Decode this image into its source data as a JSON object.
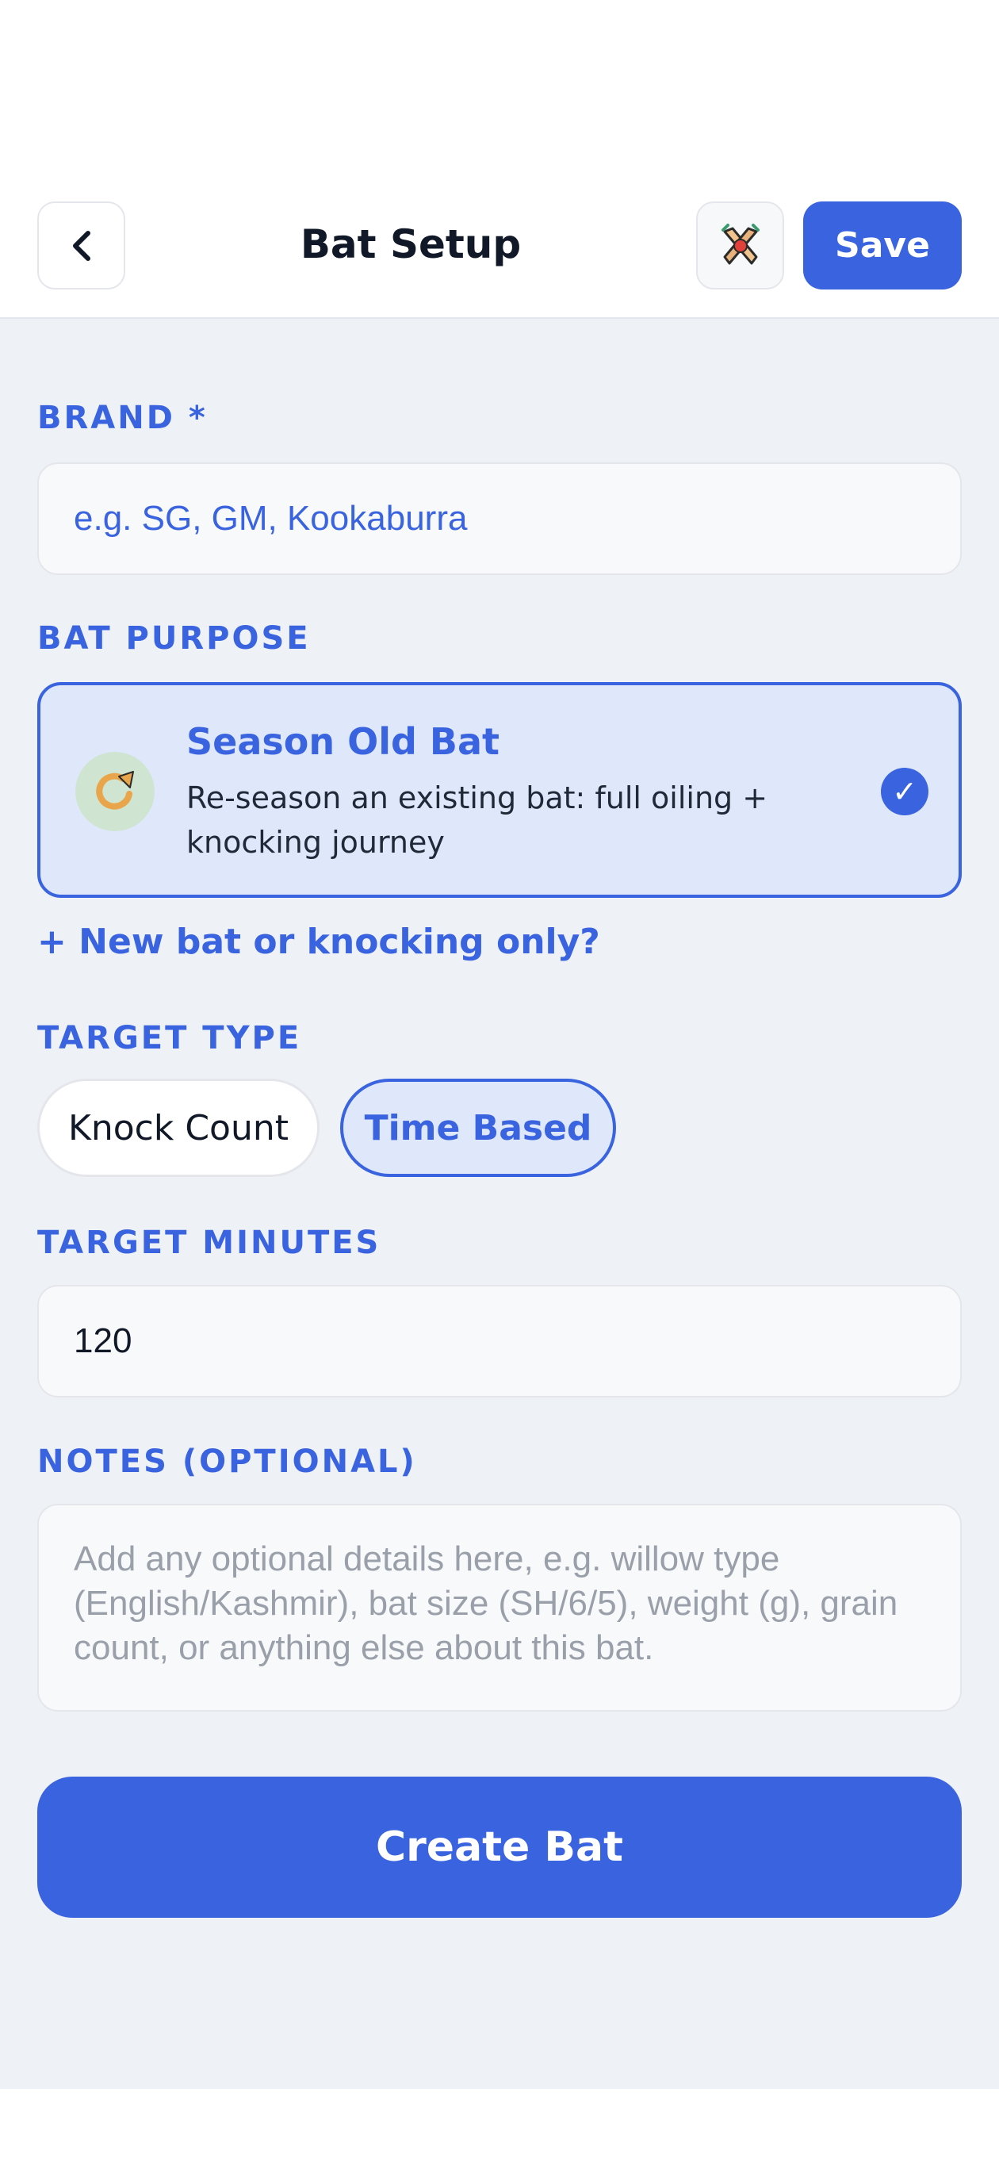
{
  "header": {
    "title": "Bat Setup",
    "back_icon": "chevron-left-icon",
    "tools_icon": "crossed-bats-icon",
    "save_label": "Save"
  },
  "form": {
    "brand": {
      "label": "BRAND *",
      "placeholder": "e.g. SG, GM, Kookaburra",
      "value": ""
    },
    "bat_purpose": {
      "label": "BAT PURPOSE",
      "selected": {
        "title": "Season Old Bat",
        "description": "Re-season an existing bat: full oiling + knocking journey",
        "icon": "refresh-icon",
        "checked": true
      },
      "alt_link": "+ New bat or knocking only?"
    },
    "target_type": {
      "label": "TARGET TYPE",
      "options": [
        "Knock Count",
        "Time Based"
      ],
      "selected": "Time Based"
    },
    "target_minutes": {
      "label": "TARGET MINUTES",
      "value": "120"
    },
    "notes": {
      "label": "NOTES (OPTIONAL)",
      "placeholder": "Add any optional details here, e.g. willow type (English/Kashmir), bat size (SH/6/5), weight (g), grain count, or anything else about this bat.",
      "value": ""
    },
    "create_label": "Create Bat"
  },
  "colors": {
    "accent": "#3a63e0",
    "background": "#eef1f6",
    "selected_fill": "#dfe8fb"
  }
}
